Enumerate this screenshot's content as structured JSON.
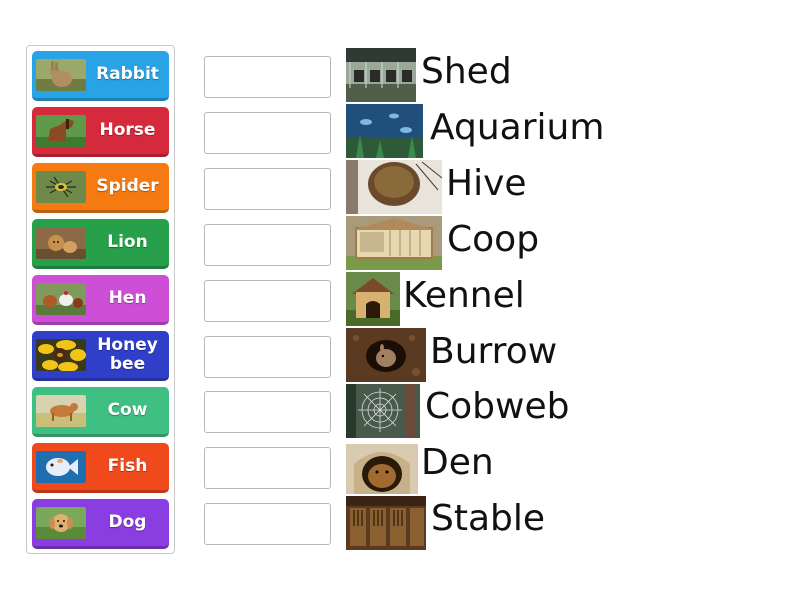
{
  "tiles": [
    {
      "label": "Rabbit",
      "color": "#27a3e6",
      "icon": "rabbit-photo"
    },
    {
      "label": "Horse",
      "color": "#d62a3c",
      "icon": "horse-photo"
    },
    {
      "label": "Spider",
      "color": "#f57a12",
      "icon": "spider-photo"
    },
    {
      "label": "Lion",
      "color": "#26a04b",
      "icon": "lion-photo"
    },
    {
      "label": "Hen",
      "color": "#cc4fd6",
      "icon": "hen-photo"
    },
    {
      "label": "Honey\nbee",
      "color": "#2f3fc8",
      "icon": "honeybee-photo"
    },
    {
      "label": "Cow",
      "color": "#3fbf82",
      "icon": "cow-photo"
    },
    {
      "label": "Fish",
      "color": "#f04a1c",
      "icon": "fish-photo"
    },
    {
      "label": "Dog",
      "color": "#8a3de0",
      "icon": "dog-photo"
    }
  ],
  "targets": [
    {
      "label": "Shed",
      "icon": "shed-photo"
    },
    {
      "label": "Aquarium",
      "icon": "aquarium-photo"
    },
    {
      "label": "Hive",
      "icon": "hive-photo"
    },
    {
      "label": "Coop",
      "icon": "coop-photo"
    },
    {
      "label": "Kennel",
      "icon": "kennel-photo"
    },
    {
      "label": "Burrow",
      "icon": "burrow-photo"
    },
    {
      "label": "Cobweb",
      "icon": "cobweb-photo"
    },
    {
      "label": "Den",
      "icon": "den-photo"
    },
    {
      "label": "Stable",
      "icon": "stable-photo"
    }
  ]
}
